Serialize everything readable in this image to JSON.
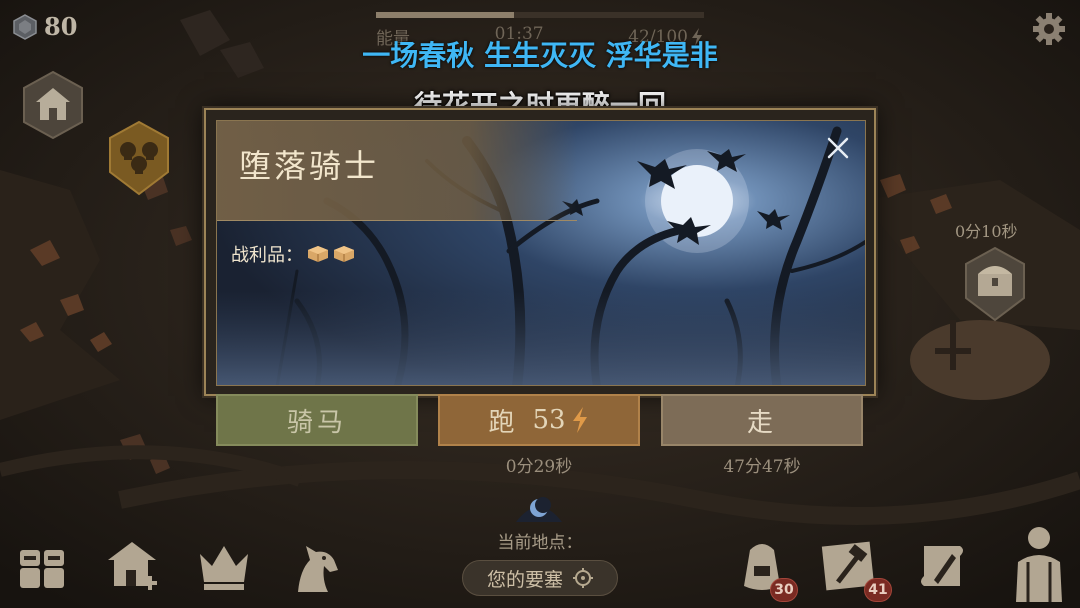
{
  "hud": {
    "currency_value": "80",
    "energy_label": "能量",
    "energy_timer": "01:37",
    "energy_count": "42/100",
    "energy_fraction": 0.42
  },
  "lyrics": {
    "line1": "一场春秋 生生灭灭 浮华是非",
    "line2": "待花开之时再醉一回"
  },
  "map": {
    "chest_timer": "0分10秒"
  },
  "dialog": {
    "title": "堕落骑士",
    "loot_label": "战利品：",
    "actions": [
      {
        "label": "骑马",
        "sub": ""
      },
      {
        "label": "跑",
        "cost": "53",
        "sub": "0分29秒"
      },
      {
        "label": "走",
        "sub": "47分47秒"
      }
    ]
  },
  "bottom": {
    "location_label": "当前地点：",
    "location_name": "您的要塞",
    "badge_backpack": "30",
    "badge_craft": "41"
  },
  "colors": {
    "lyric_blue": "#3fb7f5",
    "ride_green": "#6f7549",
    "run_orange": "#8f6638",
    "walk_brown": "#7d6c57",
    "badge_red": "#7a2a22"
  },
  "icons": [
    "currency-gem-icon",
    "lightning-icon",
    "gear-icon",
    "house-icon",
    "skulls-icon",
    "chest-icon",
    "close-icon",
    "loot-box-icon",
    "target-icon",
    "characters-icon",
    "build-house-icon",
    "crown-icon",
    "horse-icon",
    "backpack-icon",
    "craft-hammer-icon",
    "quest-scroll-icon",
    "character-equipment-icon"
  ]
}
